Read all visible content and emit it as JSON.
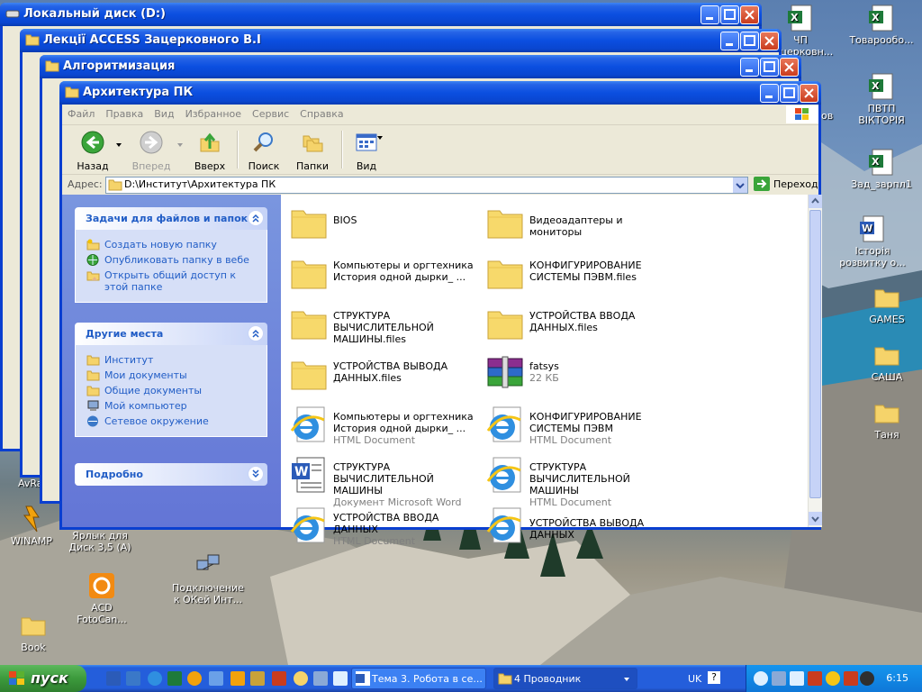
{
  "windows_back": [
    {
      "title": "Локальный диск (D:)"
    },
    {
      "title": "Лекції ACCESS Зацерковного В.І"
    },
    {
      "title": "Алгоритмизация"
    }
  ],
  "window": {
    "title": "Архитектура ПК",
    "menu": [
      "Файл",
      "Правка",
      "Вид",
      "Избранное",
      "Сервис",
      "Справка"
    ],
    "toolbar": {
      "back": "Назад",
      "forward": "Вперед",
      "up": "Вверх",
      "search": "Поиск",
      "folders": "Папки",
      "view": "Вид"
    },
    "address": {
      "label": "Адрес:",
      "value": "D:\\Институт\\Архитектура ПК",
      "go": "Переход"
    },
    "tasks": {
      "title": "Задачи для файлов и папок",
      "items": [
        "Создать новую папку",
        "Опубликовать папку в вебе",
        "Открыть общий доступ к этой папке"
      ]
    },
    "places": {
      "title": "Другие места",
      "items": [
        "Институт",
        "Мои документы",
        "Общие документы",
        "Мой компьютер",
        "Сетевое окружение"
      ]
    },
    "details": {
      "title": "Подробно"
    },
    "files": [
      {
        "name": "BIOS",
        "type": "",
        "icon": "folder"
      },
      {
        "name": "Видеоадаптеры и мониторы",
        "type": "",
        "icon": "folder"
      },
      {
        "name": "Компьютеры и оргтехника История одной дырки_ ...",
        "type": "",
        "icon": "folder"
      },
      {
        "name": "КОНФИГУРИРОВАНИЕ СИСТЕМЫ ПЭВМ.files",
        "type": "",
        "icon": "folder"
      },
      {
        "name": "СТРУКТУРА ВЫЧИСЛИТЕЛЬНОЙ МАШИНЫ.files",
        "type": "",
        "icon": "folder"
      },
      {
        "name": "УСТРОЙСТВА ВВОДА ДАННЫХ.files",
        "type": "",
        "icon": "folder"
      },
      {
        "name": "УСТРОЙСТВА ВЫВОДА ДАННЫХ.files",
        "type": "",
        "icon": "folder"
      },
      {
        "name": "fatsys",
        "type": "22 КБ",
        "icon": "rar"
      },
      {
        "name": "Компьютеры и оргтехника История одной дырки_ ...",
        "type": "HTML Document",
        "icon": "ie"
      },
      {
        "name": "КОНФИГУРИРОВАНИЕ СИСТЕМЫ ПЭВМ",
        "type": "HTML Document",
        "icon": "ie"
      },
      {
        "name": "СТРУКТУРА ВЫЧИСЛИТЕЛЬНОЙ МАШИНЫ",
        "type": "Документ Microsoft Word",
        "icon": "word"
      },
      {
        "name": "СТРУКТУРА ВЫЧИСЛИТЕЛЬНОЙ МАШИНЫ",
        "type": "HTML Document",
        "icon": "ie"
      },
      {
        "name": "УСТРОЙСТВА ВВОДА ДАННЫХ",
        "type": "HTML Document",
        "icon": "ie"
      },
      {
        "name": "УСТРОЙСТВА ВЫВОДА ДАННЫХ",
        "type": "",
        "icon": "ie"
      }
    ]
  },
  "desktop": {
    "right": [
      {
        "label": "ЧП Зацерковн...",
        "icon": "excel"
      },
      {
        "label": "Товарообо...",
        "icon": "excel"
      },
      {
        "label": "ПВТП ВІКТОРІЯ",
        "icon": "excel"
      },
      {
        "label": "Зад_зарпл1",
        "icon": "excel"
      },
      {
        "label": "Історія розвитку о...",
        "icon": "word"
      },
      {
        "label": "GAMES",
        "icon": "folder"
      },
      {
        "label": "САША",
        "icon": "folder"
      },
      {
        "label": "Таня",
        "icon": "folder"
      }
    ],
    "left": [
      {
        "label": "AvRa",
        "icon": "app"
      },
      {
        "label": "WINAMP",
        "icon": "winamp"
      },
      {
        "label": "Ярлык для Диск 3,5 (А)",
        "icon": "none"
      },
      {
        "label": "ACD FotoCan...",
        "icon": "acd"
      },
      {
        "label": "Подключение к ОКей Инт...",
        "icon": "net"
      },
      {
        "label": "Book",
        "icon": "folder"
      }
    ],
    "edge_label": "ов"
  },
  "taskbar": {
    "start": "пуск",
    "tasks": [
      "Тема 3. Робота в се...",
      "4 Проводник"
    ],
    "lang": "UK",
    "help": "?",
    "clock": "6:15"
  },
  "colors": {
    "accent": "#0a46d0",
    "link": "#215dc6",
    "taskbar": "#245edb",
    "start": "#3c9a3c"
  }
}
